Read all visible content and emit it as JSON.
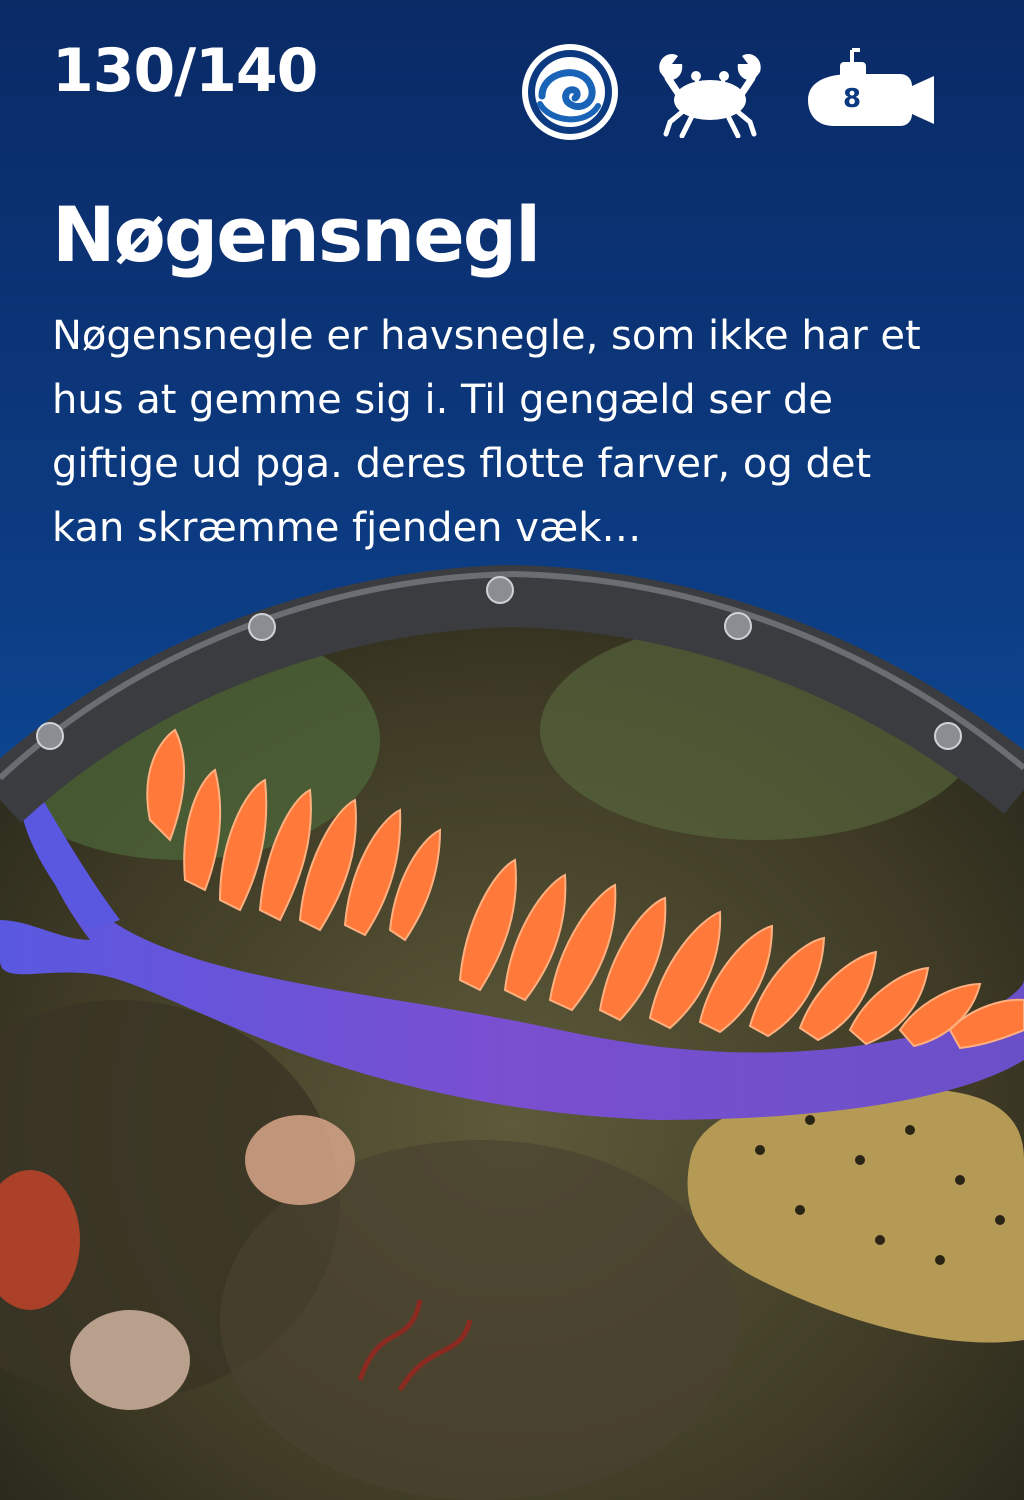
{
  "card": {
    "counter": "130/140",
    "title": "Nøgensnegl",
    "description": "Nøgensnegle er havsnegle, som ikke har et hus at gemme sig i. Til gengæld ser de giftige ud pga. deres flotte farver, og det kan skræmme fjenden væk…"
  },
  "icons": {
    "habitat": "wave-spiral-icon",
    "category": "crab-icon",
    "depth": {
      "icon": "submarine-icon",
      "value": "8"
    }
  },
  "colors": {
    "background": "#0c3a80",
    "text": "#ffffff",
    "nudibranch_body": "#6a4fd0",
    "nudibranch_cerata": "#ff7a3a"
  }
}
